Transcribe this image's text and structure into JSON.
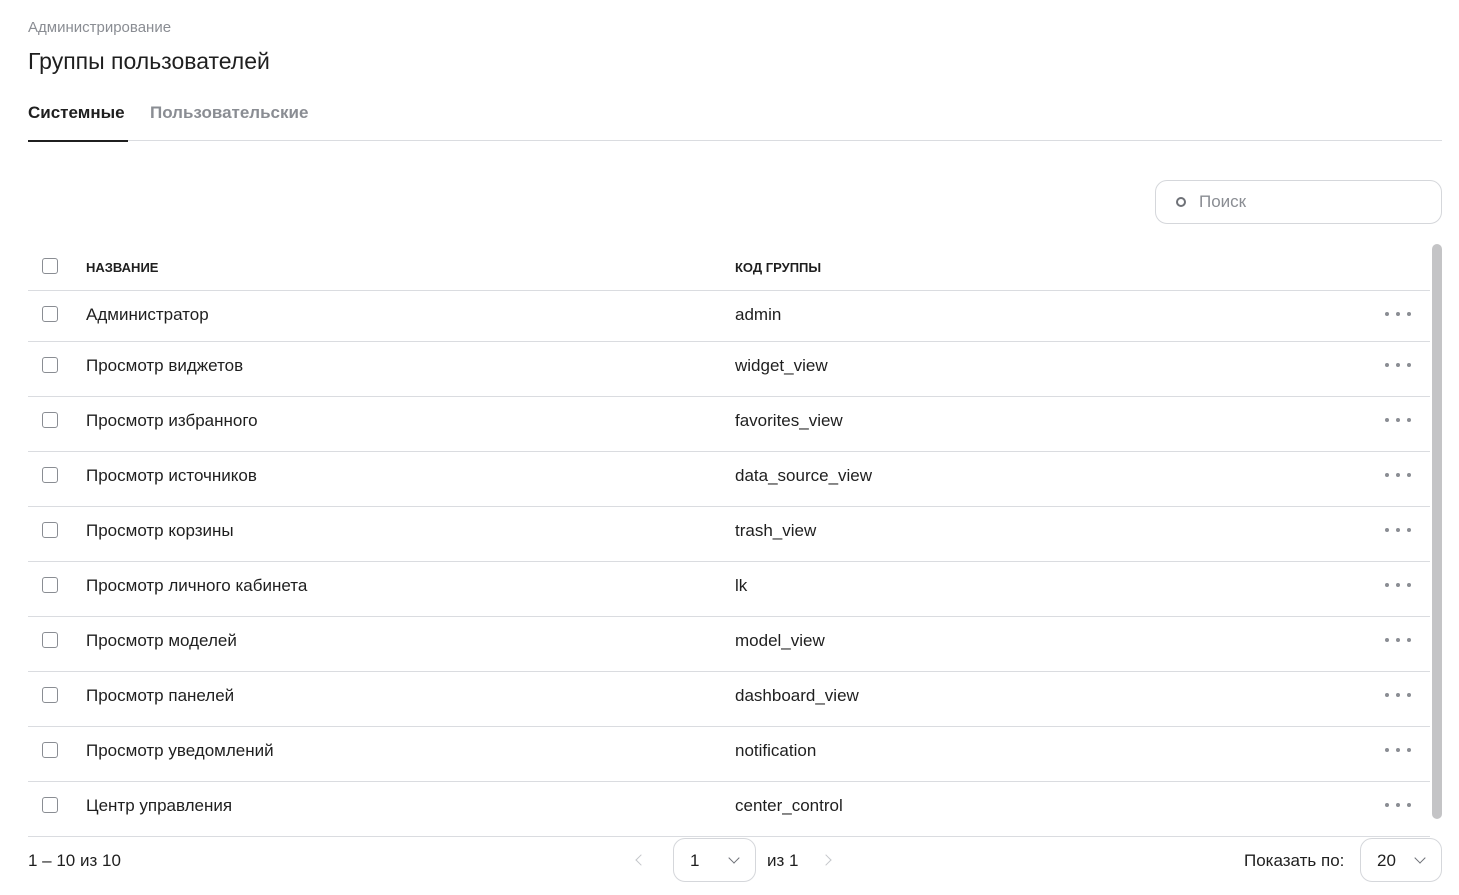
{
  "breadcrumb": "Администрирование",
  "title": "Группы пользователей",
  "tabs": [
    {
      "label": "Системные",
      "active": true
    },
    {
      "label": "Пользовательские",
      "active": false
    }
  ],
  "search": {
    "placeholder": "Поиск",
    "value": ""
  },
  "table": {
    "columns": [
      "НАЗВАНИЕ",
      "КОД ГРУППЫ"
    ],
    "rows": [
      {
        "name": "Администратор",
        "code": "admin"
      },
      {
        "name": "Просмотр виджетов",
        "code": "widget_view"
      },
      {
        "name": "Просмотр избранного",
        "code": "favorites_view"
      },
      {
        "name": "Просмотр источников",
        "code": "data_source_view"
      },
      {
        "name": "Просмотр корзины",
        "code": "trash_view"
      },
      {
        "name": "Просмотр личного кабинета",
        "code": "lk"
      },
      {
        "name": "Просмотр моделей",
        "code": "model_view"
      },
      {
        "name": "Просмотр панелей",
        "code": "dashboard_view"
      },
      {
        "name": "Просмотр уведомлений",
        "code": "notification"
      },
      {
        "name": "Центр управления",
        "code": "center_control"
      }
    ]
  },
  "pagination": {
    "range": "1 – 10 из 10",
    "current_page": "1",
    "of_pages": "из 1",
    "page_size_label": "Показать по:",
    "page_size": "20"
  },
  "colors": {
    "text": "#1f1f1f",
    "muted": "#8a8d93",
    "border": "#dadce0"
  }
}
